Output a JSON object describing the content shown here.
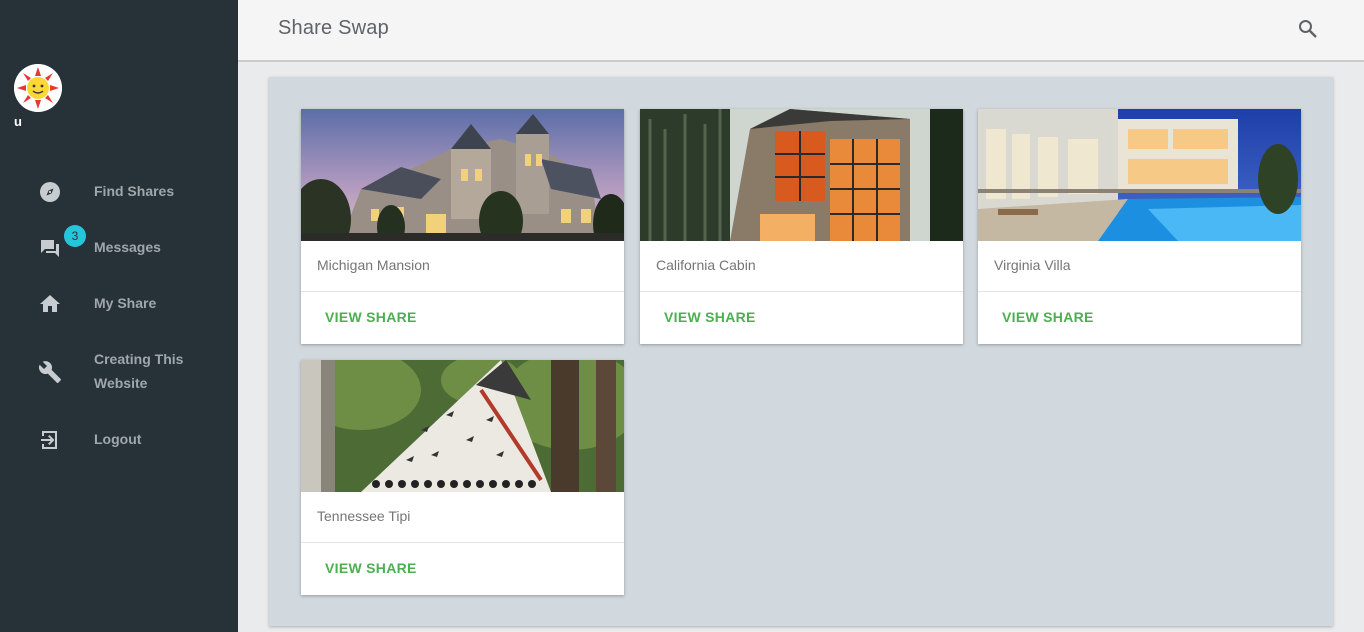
{
  "user": {
    "name": "u"
  },
  "header": {
    "title": "Share Swap"
  },
  "sidebar": {
    "items": [
      {
        "label": "Find Shares",
        "icon": "compass-icon"
      },
      {
        "label": "Messages",
        "icon": "chat-icon",
        "badge": "3"
      },
      {
        "label": "My Share",
        "icon": "home-icon"
      },
      {
        "label": "Creating This Website",
        "icon": "wrench-icon"
      },
      {
        "label": "Logout",
        "icon": "logout-icon"
      }
    ]
  },
  "cards": [
    {
      "title": "Michigan Mansion",
      "action": "VIEW SHARE"
    },
    {
      "title": "California Cabin",
      "action": "VIEW SHARE"
    },
    {
      "title": "Virginia Villa",
      "action": "VIEW SHARE"
    },
    {
      "title": "Tennessee Tipi",
      "action": "VIEW SHARE"
    }
  ],
  "colors": {
    "sidebar": "#263238",
    "accent": "#4caf50",
    "badge": "#26c6da",
    "main_bg": "#d1d9de"
  }
}
